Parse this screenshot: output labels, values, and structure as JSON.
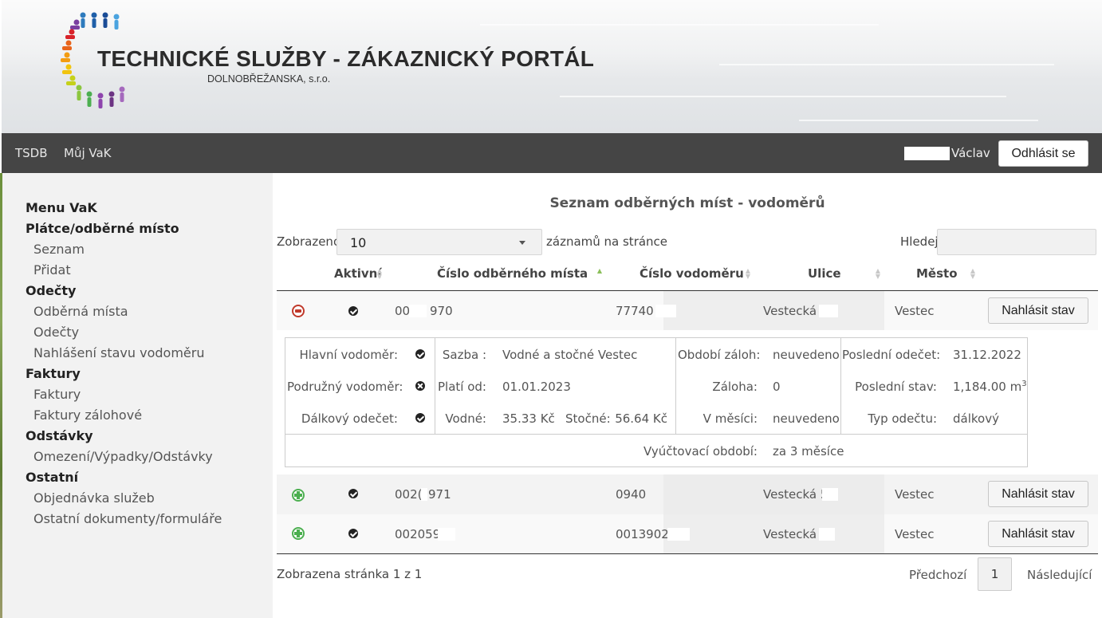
{
  "brand": {
    "title": "TECHNICKÉ  SLUŽBY - ZÁKAZNICKÝ PORTÁL",
    "subtitle": "DOLNOBŘEŽANSKA, s.r.o."
  },
  "nav": {
    "items": [
      "TSDB",
      "Můj VaK"
    ],
    "user_name": "Václav",
    "logout_label": "Odhlásit se"
  },
  "sidebar": {
    "sections": [
      {
        "label": "Menu VaK",
        "items": []
      },
      {
        "label": "Plátce/odběrné místo",
        "items": [
          "Seznam",
          "Přidat"
        ]
      },
      {
        "label": "Odečty",
        "items": [
          "Odběrná místa",
          "Odečty",
          "Nahlášení stavu vodoměru"
        ]
      },
      {
        "label": "Faktury",
        "items": [
          "Faktury",
          "Faktury zálohové"
        ]
      },
      {
        "label": "Odstávky",
        "items": [
          "Omezení/Výpadky/Odstávky"
        ]
      },
      {
        "label": "Ostatní",
        "items": [
          "Objednávka služeb",
          "Ostatní dokumenty/formuláře"
        ]
      }
    ]
  },
  "main": {
    "title": "Seznam odběrných míst - vodoměrů",
    "length": {
      "prefix": "Zobrazeno",
      "value": "10",
      "suffix": "záznamů na stránce"
    },
    "search_label": "Hledej:",
    "columns": [
      "Aktivní",
      "Číslo odběrného místa",
      "Číslo vodoměru",
      "Ulice",
      "Město"
    ],
    "rows": [
      {
        "place": "00",
        "place_tail": "970",
        "meter": "77740",
        "street": "Vestecká 5",
        "city": "Vestec",
        "action": "Nahlásit stav",
        "expanded": true
      },
      {
        "place": "002(",
        "place_tail": "971",
        "meter": "0940",
        "street": "Vestecká 5!",
        "city": "Vestec",
        "action": "Nahlásit stav",
        "expanded": false
      },
      {
        "place": "002059",
        "place_tail": "",
        "meter": "0013902",
        "street": "Vestecká 5",
        "city": "Vestec",
        "action": "Nahlásit stav",
        "expanded": false
      }
    ],
    "detail": {
      "main_meter": "Hlavní vodoměr:",
      "sub_meter": "Podružný vodoměr:",
      "remote": "Dálkový odečet:",
      "rate_label": "Sazba :",
      "rate_value": "Vodné a stočné Vestec",
      "valid_label": "Platí od:",
      "valid_value": "01.01.2023",
      "water_label": "Vodné:",
      "water_value": "35.33 Kč",
      "sewer_label": "Stočné:",
      "sewer_value": "56.64 Kč",
      "period_label": "Období záloh:",
      "period_value": "neuvedeno",
      "deposit_label": "Záloha:",
      "deposit_value": "0",
      "month_label": "V měsíci:",
      "month_value": "neuvedeno",
      "last_read_label": "Poslední odečet:",
      "last_read_value": "31.12.2022",
      "last_state_label": "Poslední stav:",
      "last_state_value": "1,184.00 m",
      "last_state_unit_sup": "3",
      "read_type_label": "Typ odečtu:",
      "read_type_value": "dálkový",
      "billing_label": "Vyúčtovací období:",
      "billing_value": "za 3 měsíce"
    },
    "footer": {
      "info": "Zobrazena stránka 1 z 1",
      "prev": "Předchozí",
      "page": "1",
      "next": "Následující"
    }
  },
  "colors": {
    "navbar": "#454545",
    "sidebar": "#f2f2f2",
    "minus": "#c0392b",
    "plus": "#4caf50"
  }
}
